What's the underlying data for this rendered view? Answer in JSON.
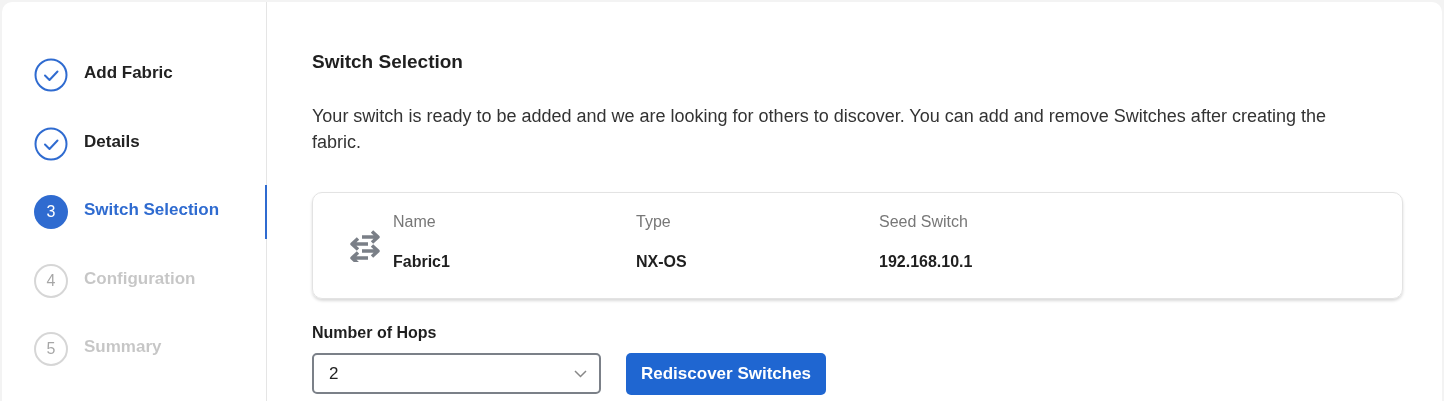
{
  "steps": [
    {
      "kind": "check",
      "label": "Add Fabric",
      "selected": false,
      "disabled": false
    },
    {
      "kind": "check",
      "label": "Details",
      "selected": false,
      "disabled": false
    },
    {
      "kind": "number",
      "number": "3",
      "label": "Switch Selection",
      "selected": true,
      "disabled": false
    },
    {
      "kind": "number",
      "number": "4",
      "label": "Configuration",
      "selected": false,
      "disabled": true
    },
    {
      "kind": "number",
      "number": "5",
      "label": "Summary",
      "selected": false,
      "disabled": true
    }
  ],
  "title": "Switch Selection",
  "description": "Your switch is ready to be added and we are looking for others to discover. You can add and remove Switches after creating the fabric.",
  "switch_card": {
    "columns": [
      {
        "label": "Name",
        "value": "Fabric1"
      },
      {
        "label": "Type",
        "value": "NX-OS"
      },
      {
        "label": "Seed Switch",
        "value": "192.168.10.1"
      }
    ]
  },
  "hops": {
    "label": "Number of Hops",
    "value": "2"
  },
  "rediscover_button": "Rediscover Switches"
}
